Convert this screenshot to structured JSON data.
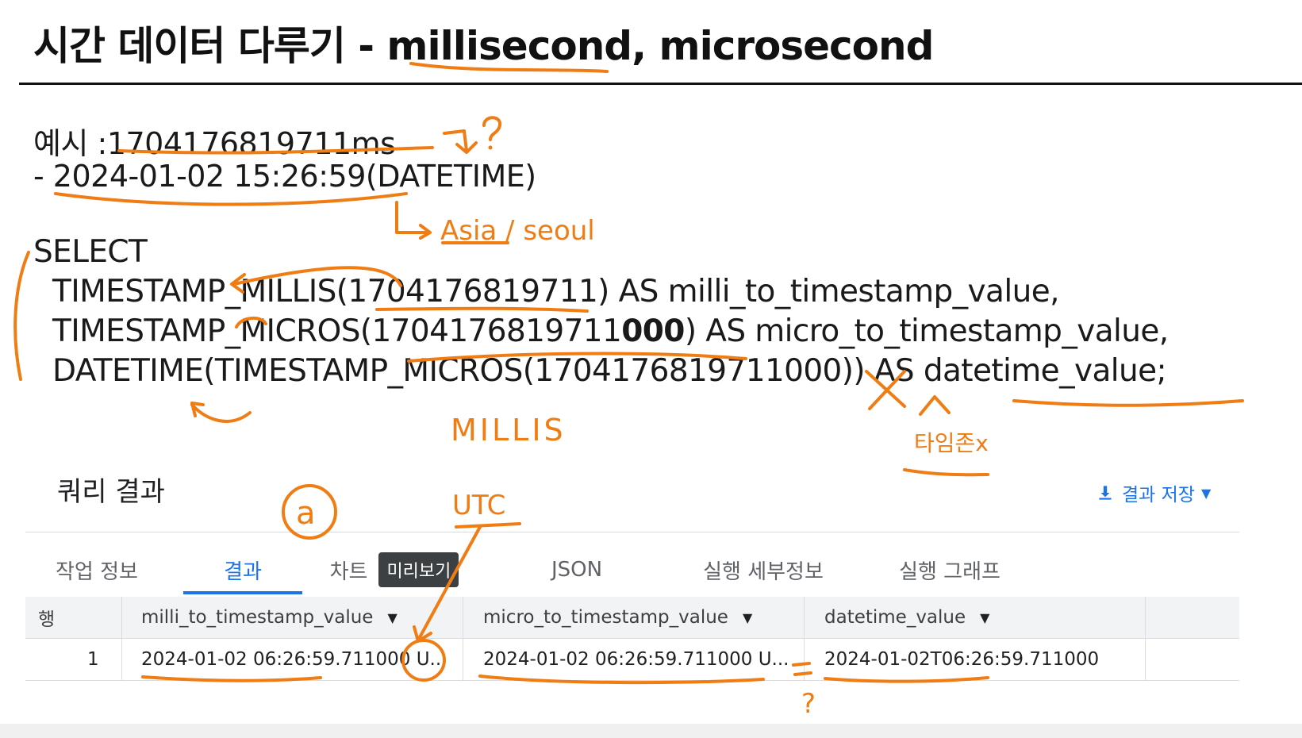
{
  "title": "시간 데이터 다루기 - millisecond, microsecond",
  "example": {
    "label": "예시 :",
    "value": "1704176819711ms",
    "datetime_line": "- 2024-01-02 15:26:59(DATETIME)"
  },
  "code": {
    "line1": "SELECT",
    "line2": "TIMESTAMP_MILLIS(1704176819711) AS milli_to_timestamp_value,",
    "line3_a": "TIMESTAMP_MICROS(1704176819711",
    "line3_b": "000",
    "line3_c": ") AS micro_to_timestamp_value,",
    "line4": "DATETIME(TIMESTAMP_MICROS(1704176819711000)) AS datetime_value;"
  },
  "annotations": {
    "timezone": "Asia / seoul",
    "millis": "MILLIS",
    "timezone_x": "타임존x",
    "utc": "UTC",
    "circle_a": "a",
    "question": "?"
  },
  "results": {
    "title": "쿼리 결과",
    "save_label": "결과 저장",
    "tabs": [
      "작업 정보",
      "결과",
      "차트",
      "JSON",
      "실행 세부정보",
      "실행 그래프"
    ],
    "preview_badge": "미리보기",
    "columns": [
      "행",
      "milli_to_timestamp_value",
      "micro_to_timestamp_value",
      "datetime_value"
    ],
    "rows": [
      {
        "row": "1",
        "milli": "2024-01-02 06:26:59.711000 U...",
        "micro": "2024-01-02 06:26:59.711000 U...",
        "datetime": "2024-01-02T06:26:59.711000"
      }
    ]
  },
  "colors": {
    "accent": "#1a73e8",
    "annotation": "#f07c14"
  }
}
